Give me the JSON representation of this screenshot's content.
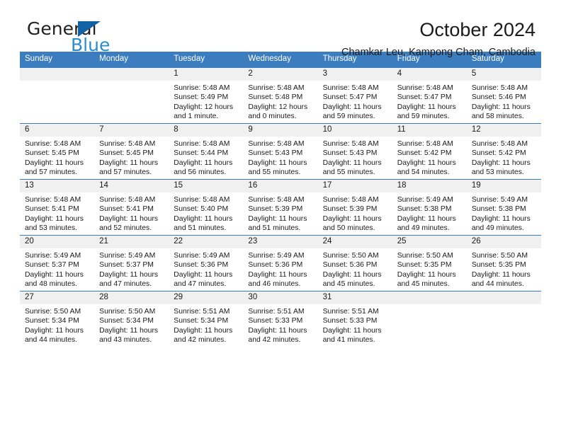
{
  "brand": {
    "name_primary": "General",
    "name_secondary": "Blue",
    "triangle_color": "#1163a6",
    "blue_color": "#2b8ccc"
  },
  "header": {
    "title": "October 2024",
    "subtitle": "Chamkar Leu, Kampong Cham, Cambodia"
  },
  "theme": {
    "header_bg": "#3b7dbf",
    "header_text": "#ffffff",
    "daynum_band_bg": "#f0f0f0",
    "row_border": "#3b7dbf"
  },
  "calendar": {
    "weekday_headers": [
      "Sunday",
      "Monday",
      "Tuesday",
      "Wednesday",
      "Thursday",
      "Friday",
      "Saturday"
    ],
    "weeks": [
      [
        {
          "empty": true
        },
        {
          "empty": true
        },
        {
          "day": "1",
          "sunrise": "Sunrise: 5:48 AM",
          "sunset": "Sunset: 5:49 PM",
          "daylight_1": "Daylight: 12 hours",
          "daylight_2": "and 1 minute."
        },
        {
          "day": "2",
          "sunrise": "Sunrise: 5:48 AM",
          "sunset": "Sunset: 5:48 PM",
          "daylight_1": "Daylight: 12 hours",
          "daylight_2": "and 0 minutes."
        },
        {
          "day": "3",
          "sunrise": "Sunrise: 5:48 AM",
          "sunset": "Sunset: 5:47 PM",
          "daylight_1": "Daylight: 11 hours",
          "daylight_2": "and 59 minutes."
        },
        {
          "day": "4",
          "sunrise": "Sunrise: 5:48 AM",
          "sunset": "Sunset: 5:47 PM",
          "daylight_1": "Daylight: 11 hours",
          "daylight_2": "and 59 minutes."
        },
        {
          "day": "5",
          "sunrise": "Sunrise: 5:48 AM",
          "sunset": "Sunset: 5:46 PM",
          "daylight_1": "Daylight: 11 hours",
          "daylight_2": "and 58 minutes."
        }
      ],
      [
        {
          "day": "6",
          "sunrise": "Sunrise: 5:48 AM",
          "sunset": "Sunset: 5:45 PM",
          "daylight_1": "Daylight: 11 hours",
          "daylight_2": "and 57 minutes."
        },
        {
          "day": "7",
          "sunrise": "Sunrise: 5:48 AM",
          "sunset": "Sunset: 5:45 PM",
          "daylight_1": "Daylight: 11 hours",
          "daylight_2": "and 57 minutes."
        },
        {
          "day": "8",
          "sunrise": "Sunrise: 5:48 AM",
          "sunset": "Sunset: 5:44 PM",
          "daylight_1": "Daylight: 11 hours",
          "daylight_2": "and 56 minutes."
        },
        {
          "day": "9",
          "sunrise": "Sunrise: 5:48 AM",
          "sunset": "Sunset: 5:43 PM",
          "daylight_1": "Daylight: 11 hours",
          "daylight_2": "and 55 minutes."
        },
        {
          "day": "10",
          "sunrise": "Sunrise: 5:48 AM",
          "sunset": "Sunset: 5:43 PM",
          "daylight_1": "Daylight: 11 hours",
          "daylight_2": "and 55 minutes."
        },
        {
          "day": "11",
          "sunrise": "Sunrise: 5:48 AM",
          "sunset": "Sunset: 5:42 PM",
          "daylight_1": "Daylight: 11 hours",
          "daylight_2": "and 54 minutes."
        },
        {
          "day": "12",
          "sunrise": "Sunrise: 5:48 AM",
          "sunset": "Sunset: 5:42 PM",
          "daylight_1": "Daylight: 11 hours",
          "daylight_2": "and 53 minutes."
        }
      ],
      [
        {
          "day": "13",
          "sunrise": "Sunrise: 5:48 AM",
          "sunset": "Sunset: 5:41 PM",
          "daylight_1": "Daylight: 11 hours",
          "daylight_2": "and 53 minutes."
        },
        {
          "day": "14",
          "sunrise": "Sunrise: 5:48 AM",
          "sunset": "Sunset: 5:41 PM",
          "daylight_1": "Daylight: 11 hours",
          "daylight_2": "and 52 minutes."
        },
        {
          "day": "15",
          "sunrise": "Sunrise: 5:48 AM",
          "sunset": "Sunset: 5:40 PM",
          "daylight_1": "Daylight: 11 hours",
          "daylight_2": "and 51 minutes."
        },
        {
          "day": "16",
          "sunrise": "Sunrise: 5:48 AM",
          "sunset": "Sunset: 5:39 PM",
          "daylight_1": "Daylight: 11 hours",
          "daylight_2": "and 51 minutes."
        },
        {
          "day": "17",
          "sunrise": "Sunrise: 5:48 AM",
          "sunset": "Sunset: 5:39 PM",
          "daylight_1": "Daylight: 11 hours",
          "daylight_2": "and 50 minutes."
        },
        {
          "day": "18",
          "sunrise": "Sunrise: 5:49 AM",
          "sunset": "Sunset: 5:38 PM",
          "daylight_1": "Daylight: 11 hours",
          "daylight_2": "and 49 minutes."
        },
        {
          "day": "19",
          "sunrise": "Sunrise: 5:49 AM",
          "sunset": "Sunset: 5:38 PM",
          "daylight_1": "Daylight: 11 hours",
          "daylight_2": "and 49 minutes."
        }
      ],
      [
        {
          "day": "20",
          "sunrise": "Sunrise: 5:49 AM",
          "sunset": "Sunset: 5:37 PM",
          "daylight_1": "Daylight: 11 hours",
          "daylight_2": "and 48 minutes."
        },
        {
          "day": "21",
          "sunrise": "Sunrise: 5:49 AM",
          "sunset": "Sunset: 5:37 PM",
          "daylight_1": "Daylight: 11 hours",
          "daylight_2": "and 47 minutes."
        },
        {
          "day": "22",
          "sunrise": "Sunrise: 5:49 AM",
          "sunset": "Sunset: 5:36 PM",
          "daylight_1": "Daylight: 11 hours",
          "daylight_2": "and 47 minutes."
        },
        {
          "day": "23",
          "sunrise": "Sunrise: 5:49 AM",
          "sunset": "Sunset: 5:36 PM",
          "daylight_1": "Daylight: 11 hours",
          "daylight_2": "and 46 minutes."
        },
        {
          "day": "24",
          "sunrise": "Sunrise: 5:50 AM",
          "sunset": "Sunset: 5:36 PM",
          "daylight_1": "Daylight: 11 hours",
          "daylight_2": "and 45 minutes."
        },
        {
          "day": "25",
          "sunrise": "Sunrise: 5:50 AM",
          "sunset": "Sunset: 5:35 PM",
          "daylight_1": "Daylight: 11 hours",
          "daylight_2": "and 45 minutes."
        },
        {
          "day": "26",
          "sunrise": "Sunrise: 5:50 AM",
          "sunset": "Sunset: 5:35 PM",
          "daylight_1": "Daylight: 11 hours",
          "daylight_2": "and 44 minutes."
        }
      ],
      [
        {
          "day": "27",
          "sunrise": "Sunrise: 5:50 AM",
          "sunset": "Sunset: 5:34 PM",
          "daylight_1": "Daylight: 11 hours",
          "daylight_2": "and 44 minutes."
        },
        {
          "day": "28",
          "sunrise": "Sunrise: 5:50 AM",
          "sunset": "Sunset: 5:34 PM",
          "daylight_1": "Daylight: 11 hours",
          "daylight_2": "and 43 minutes."
        },
        {
          "day": "29",
          "sunrise": "Sunrise: 5:51 AM",
          "sunset": "Sunset: 5:34 PM",
          "daylight_1": "Daylight: 11 hours",
          "daylight_2": "and 42 minutes."
        },
        {
          "day": "30",
          "sunrise": "Sunrise: 5:51 AM",
          "sunset": "Sunset: 5:33 PM",
          "daylight_1": "Daylight: 11 hours",
          "daylight_2": "and 42 minutes."
        },
        {
          "day": "31",
          "sunrise": "Sunrise: 5:51 AM",
          "sunset": "Sunset: 5:33 PM",
          "daylight_1": "Daylight: 11 hours",
          "daylight_2": "and 41 minutes."
        },
        {
          "empty": true
        },
        {
          "empty": true
        }
      ]
    ]
  }
}
